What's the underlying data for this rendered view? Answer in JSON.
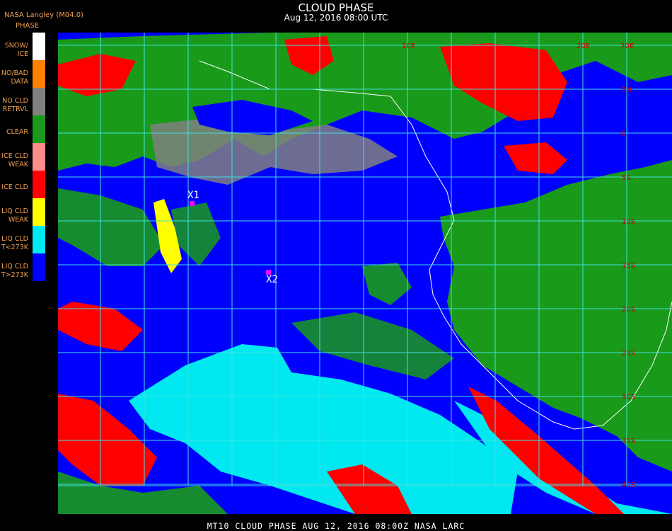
{
  "header": {
    "title": "CLOUD PHASE",
    "subtitle": "Aug 12, 2016 08:00 UTC",
    "organization": "NASA Langley (M04.0)"
  },
  "legend": {
    "title": "PHASE",
    "items": [
      {
        "label": "SNOW/\nICE",
        "color": "#ffffff"
      },
      {
        "label": "NO/BAD\nDATA",
        "color": "#ff8000"
      },
      {
        "label": "NO CLD\nRETRVL",
        "color": "#808080"
      },
      {
        "label": "CLEAR",
        "color": "#1a9a1a"
      },
      {
        "label": "ICE CLD\nWEAK",
        "color": "#ff8c8c"
      },
      {
        "label": "ICE CLD",
        "color": "#ff0000"
      },
      {
        "label": "LIQ CLD\nWEAK",
        "color": "#ffff00"
      },
      {
        "label": "LIQ CLD\nT<273K",
        "color": "#00e8f0"
      },
      {
        "label": "LIQ CLD\nT>273K",
        "color": "#0000ff"
      }
    ]
  },
  "markers": [
    {
      "label": "X1"
    },
    {
      "label": "X2"
    }
  ],
  "grid_labels": [
    "10E",
    "20E",
    "30E",
    "5N",
    "0",
    "5S",
    "10S",
    "15S",
    "20S",
    "25S",
    "30S",
    "35S",
    "40S"
  ],
  "footer": "MT10   CLOUD PHASE   AUG 12, 2016 08:00Z   NASA LARC",
  "colors": {
    "ocean_liquid": "#0000ff",
    "land_clear": "#1a9a1a",
    "ice": "#ff0000",
    "cold_liquid": "#00e8f0",
    "grid": "#40e0e0"
  }
}
